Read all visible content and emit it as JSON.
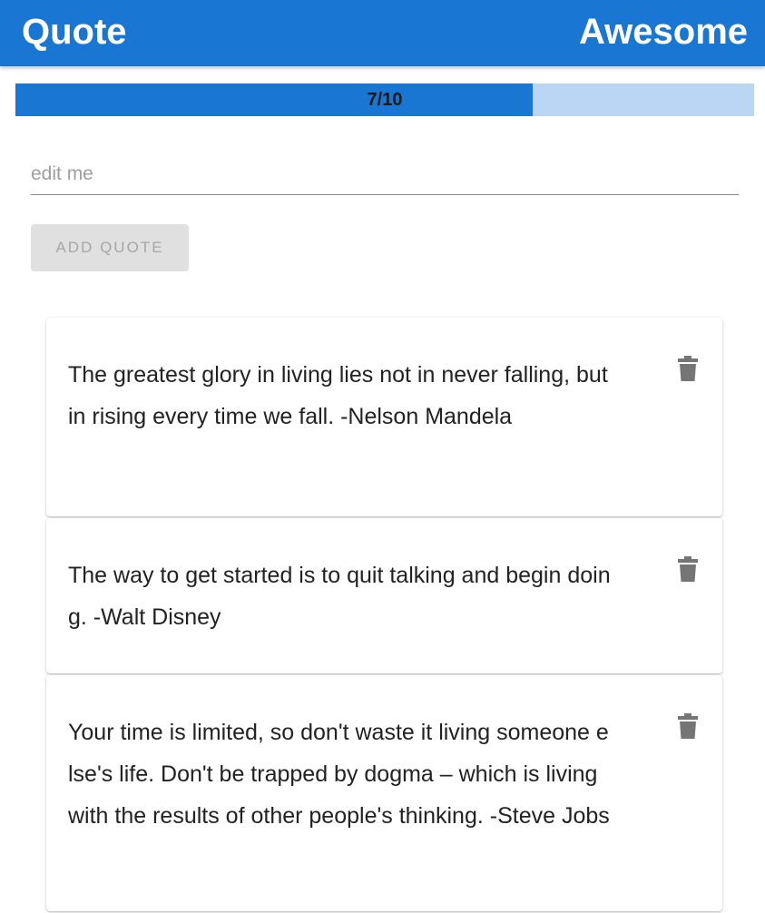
{
  "app_bar": {
    "title_left": "Quote",
    "title_right": "Awesome"
  },
  "progress": {
    "label": "7/10",
    "current": 7,
    "max": 10,
    "fill_color": "#1976d2",
    "track_color": "#bbd6f4"
  },
  "input": {
    "value": "",
    "placeholder": "edit me"
  },
  "add_button": {
    "label": "ADD QUOTE"
  },
  "quotes": [
    {
      "text": "The greatest glory in living lies not in never falling, but in rising every time we fall. -Nelson Mandela",
      "icon": "trash-icon"
    },
    {
      "text": "The way to get started is to quit talking and begin doing. -Walt Disney",
      "icon": "trash-icon"
    },
    {
      "text": "Your time is limited, so don't waste it living someone else's life. Don't be trapped by dogma – which is living with the results of other people's thinking. -Steve Jobs",
      "icon": "trash-icon"
    }
  ],
  "colors": {
    "primary": "#1976d2"
  }
}
